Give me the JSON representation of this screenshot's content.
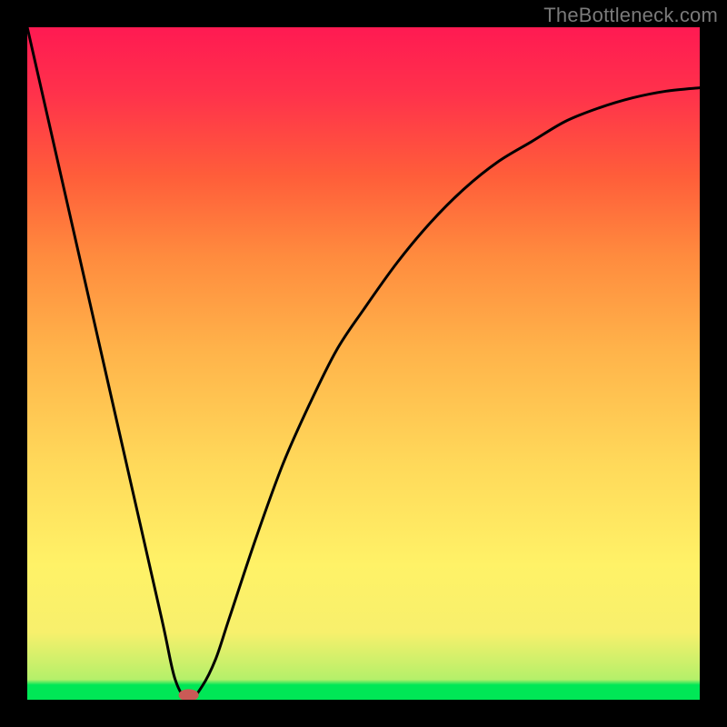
{
  "attribution": "TheBottleneck.com",
  "chart_data": {
    "type": "line",
    "title": "",
    "xlabel": "",
    "ylabel": "",
    "xlim": [
      0,
      100
    ],
    "ylim": [
      0,
      100
    ],
    "legend": false,
    "grid": false,
    "annotations": [],
    "gradient_colors_top_to_bottom": [
      "#ff1a52",
      "#ff5d3a",
      "#ffb34a",
      "#fff267",
      "#00e756"
    ],
    "series": [
      {
        "name": "bottleneck-curve",
        "type": "line",
        "stroke": "#000000",
        "stroke_width": 3,
        "x": [
          0,
          5,
          10,
          15,
          20,
          22,
          24,
          26,
          28,
          30,
          34,
          38,
          42,
          46,
          50,
          55,
          60,
          65,
          70,
          75,
          80,
          85,
          90,
          95,
          100
        ],
        "y": [
          100,
          78,
          56,
          34,
          12,
          3,
          0,
          2,
          6,
          12,
          24,
          35,
          44,
          52,
          58,
          65,
          71,
          76,
          80,
          83,
          86,
          88,
          89.5,
          90.5,
          91
        ]
      }
    ],
    "marker": {
      "name": "optimal-point",
      "shape": "ellipse",
      "cx": 24,
      "cy": 0,
      "rx": 1.5,
      "ry": 0.9,
      "fill": "#ca5a56"
    }
  }
}
